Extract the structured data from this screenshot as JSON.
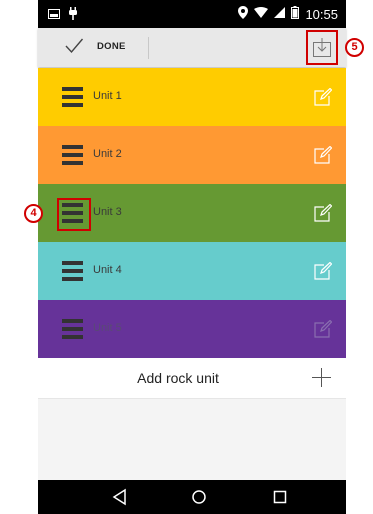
{
  "status_bar": {
    "time": "10:55",
    "icons": [
      "image-icon",
      "plug-icon",
      "location-icon",
      "wifi-icon",
      "signal-icon",
      "battery-icon"
    ]
  },
  "action_bar": {
    "done_label": "DONE",
    "icons": [
      "check-icon",
      "download-icon"
    ]
  },
  "units": [
    {
      "label": "Unit 1",
      "color": "#ffcc00",
      "label_color": "#3a3a3a"
    },
    {
      "label": "Unit 2",
      "color": "#ff9933",
      "label_color": "#3a3a3a"
    },
    {
      "label": "Unit 3",
      "color": "#669933",
      "label_color": "#3a3a3a"
    },
    {
      "label": "Unit 4",
      "color": "#66cccc",
      "label_color": "#3a3a3a"
    },
    {
      "label": "Unit 5",
      "color": "#663399",
      "label_color": "#5a4a75"
    }
  ],
  "add_row": {
    "label": "Add rock unit"
  },
  "callouts": {
    "drag_handle": "4",
    "download": "5"
  },
  "colors": {
    "callout": "#d00000",
    "action_bar": "#e8e8e8"
  }
}
